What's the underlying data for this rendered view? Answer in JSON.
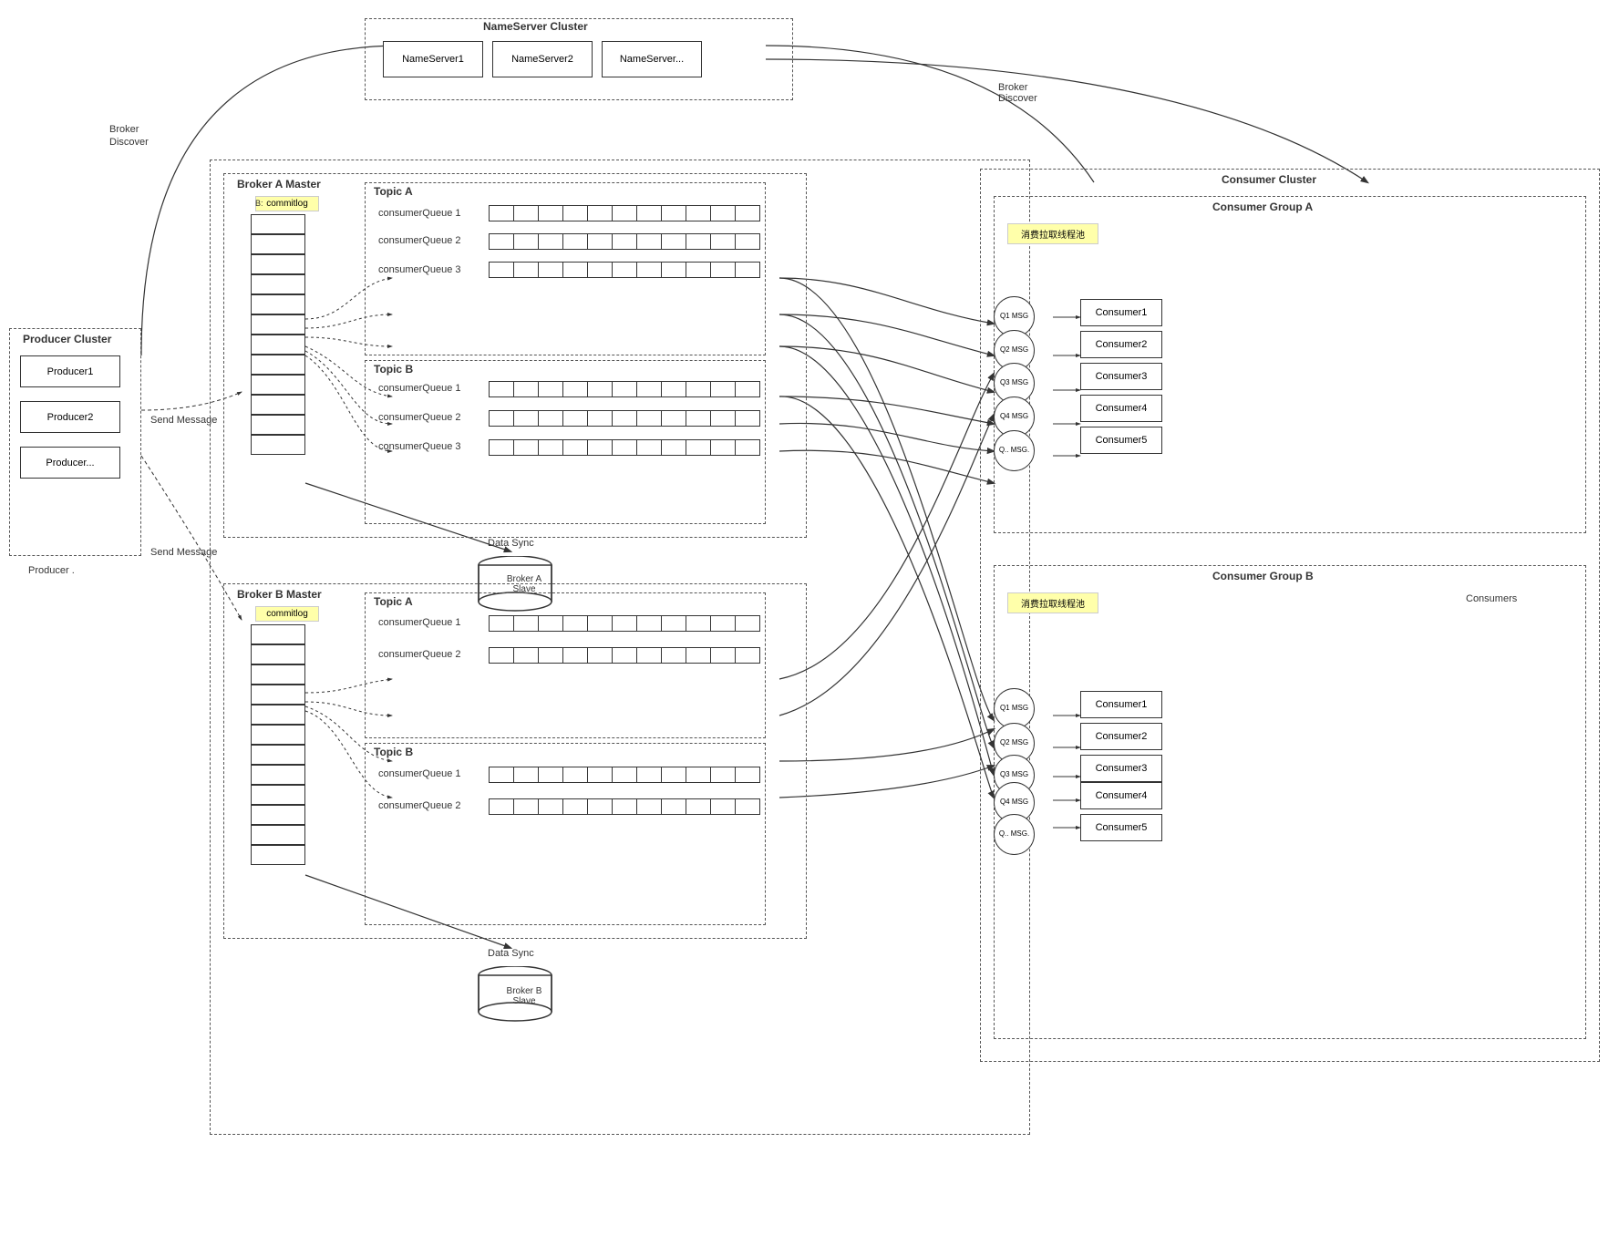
{
  "nameserver": {
    "cluster_label": "NameServer Cluster",
    "server1": "NameServer1",
    "server2": "NameServer2",
    "server3": "NameServer..."
  },
  "producer": {
    "cluster_label": "Producer Cluster",
    "p1": "Producer1",
    "p2": "Producer2",
    "p3": "Producer..."
  },
  "broker_a": {
    "master_label": "Broker A Master",
    "commitlog": "commitlog",
    "slave_label": "Broker A\nSlave",
    "data_sync": "Data Sync",
    "topic_a_label": "Topic A",
    "topic_b_label": "Topic B",
    "cq1": "consumerQueue 1",
    "cq2": "consumerQueue 2",
    "cq3": "consumerQueue 3",
    "send_msg": "Send Message"
  },
  "broker_b": {
    "master_label": "Broker B Master",
    "commitlog": "commitlog",
    "slave_label": "Broker B\nSlave",
    "data_sync": "Data Sync",
    "topic_a_label": "Topic A",
    "topic_b_label": "Topic B",
    "cq1": "consumerQueue 1",
    "cq2": "consumerQueue 2",
    "send_msg": "Send Message"
  },
  "consumer": {
    "cluster_label": "Consumer Cluster",
    "group_a_label": "Consumer Group A",
    "group_b_label": "Consumer Group B",
    "pull_thread_label": "消费拉取线程池",
    "q1msg": "Q1\nMSG",
    "q2msg": "Q2\nMSG",
    "q3msg": "Q3\nMSG",
    "q4msg": "Q4\nMSG",
    "q5msg": "Q..\nMSG.",
    "c1": "Consumer1",
    "c2": "Consumer2",
    "c3": "Consumer3",
    "c4": "Consumer4",
    "c5": "Consumer5"
  },
  "arrows": {
    "broker_discover_left": "Broker\nDiscover",
    "broker_discover_right": "Broker\nDiscover"
  }
}
